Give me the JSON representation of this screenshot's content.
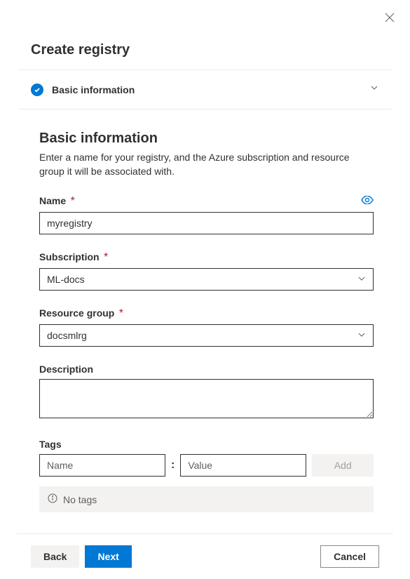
{
  "panel": {
    "title": "Create registry"
  },
  "step": {
    "title": "Basic information"
  },
  "section": {
    "heading": "Basic information",
    "description": "Enter a name for your registry, and the Azure subscription and resource group it will be associated with."
  },
  "fields": {
    "name": {
      "label": "Name",
      "value": "myregistry"
    },
    "subscription": {
      "label": "Subscription",
      "value": "ML-docs"
    },
    "resource_group": {
      "label": "Resource group",
      "value": "docsmlrg"
    },
    "description": {
      "label": "Description",
      "value": ""
    },
    "tags": {
      "label": "Tags",
      "name_placeholder": "Name",
      "value_placeholder": "Value",
      "add_label": "Add",
      "empty_message": "No tags",
      "colon": ":"
    }
  },
  "footer": {
    "back": "Back",
    "next": "Next",
    "cancel": "Cancel"
  }
}
